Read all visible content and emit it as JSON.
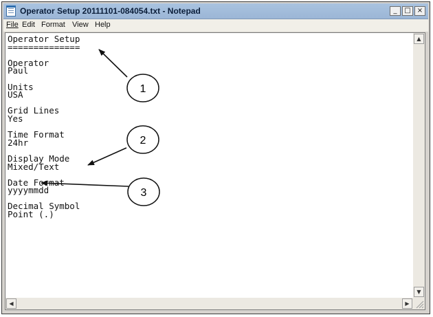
{
  "window": {
    "title": "Operator Setup 20111101-084054.txt - Notepad",
    "app_icon": "notepad-icon",
    "controls": {
      "minimize": "_",
      "maximize": "□",
      "close": "×"
    }
  },
  "menubar": {
    "items": [
      {
        "label": "File"
      },
      {
        "label": "Edit"
      },
      {
        "label": "Format"
      },
      {
        "label": "View"
      },
      {
        "label": "Help"
      }
    ]
  },
  "document": {
    "lines": [
      "Operator Setup",
      "==============",
      "",
      "Operator",
      "Paul",
      "",
      "Units",
      "USA",
      "",
      "Grid Lines",
      "Yes",
      "",
      "Time Format",
      "24hr",
      "",
      "Display Mode",
      "Mixed/Text",
      "",
      "Date Format",
      "yyyymmdd",
      "",
      "Decimal Symbol",
      "Point (.)"
    ]
  },
  "scrollbars": {
    "up_icon": "arrow-up-icon",
    "down_icon": "arrow-down-icon",
    "left_icon": "arrow-left-icon",
    "right_icon": "arrow-right-icon",
    "up": "▲",
    "down": "▼",
    "left": "◀",
    "right": "▶"
  },
  "callouts": [
    {
      "number": "1"
    },
    {
      "number": "2"
    },
    {
      "number": "3"
    }
  ]
}
